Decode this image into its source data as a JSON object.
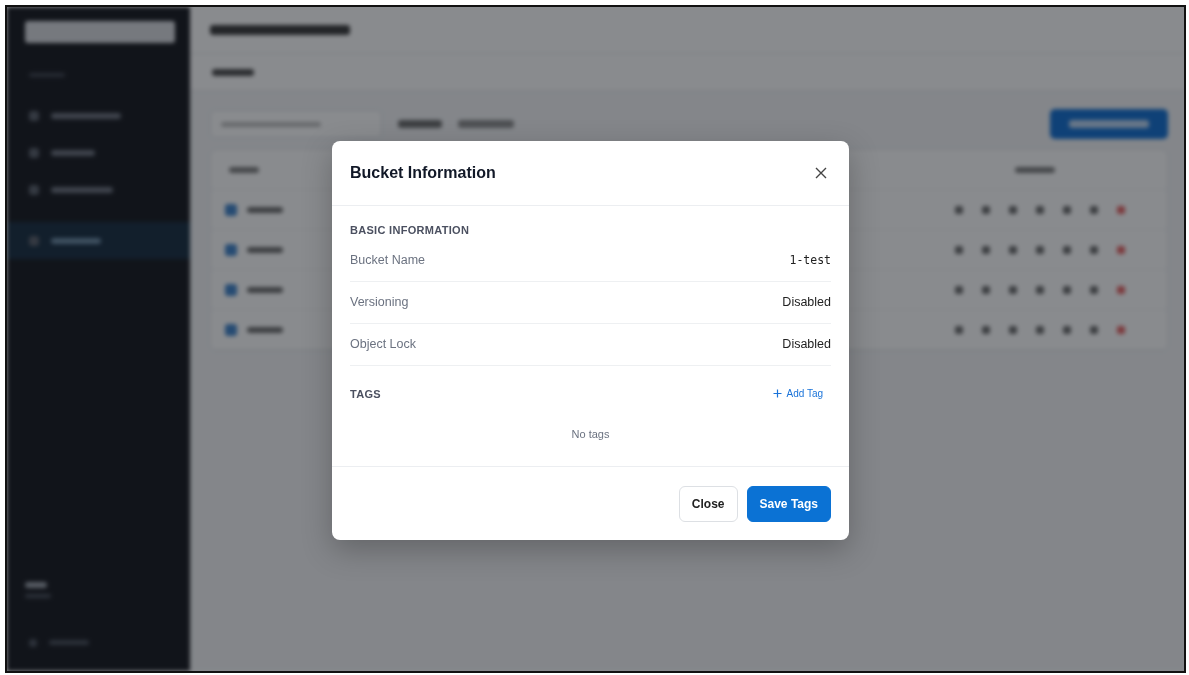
{
  "sidebar": {
    "items": [
      {
        "selected": false
      },
      {
        "selected": false
      },
      {
        "selected": false
      },
      {
        "selected": true
      }
    ]
  },
  "dialog": {
    "title": "Bucket Information",
    "section": {
      "heading": "BASIC INFORMATION",
      "rows": [
        {
          "label": "Bucket Name",
          "value": "1-test",
          "kind": "mono"
        },
        {
          "label": "Versioning",
          "value": "Disabled",
          "kind": "text"
        },
        {
          "label": "Object Lock",
          "value": "Disabled",
          "kind": "text"
        }
      ]
    },
    "tags": {
      "heading": "TAGS",
      "add_label": "Add Tag",
      "empty": "No tags"
    },
    "buttons": [
      {
        "label": "Close",
        "kind": "secondary"
      },
      {
        "label": "Save Tags",
        "kind": "primary"
      }
    ]
  }
}
